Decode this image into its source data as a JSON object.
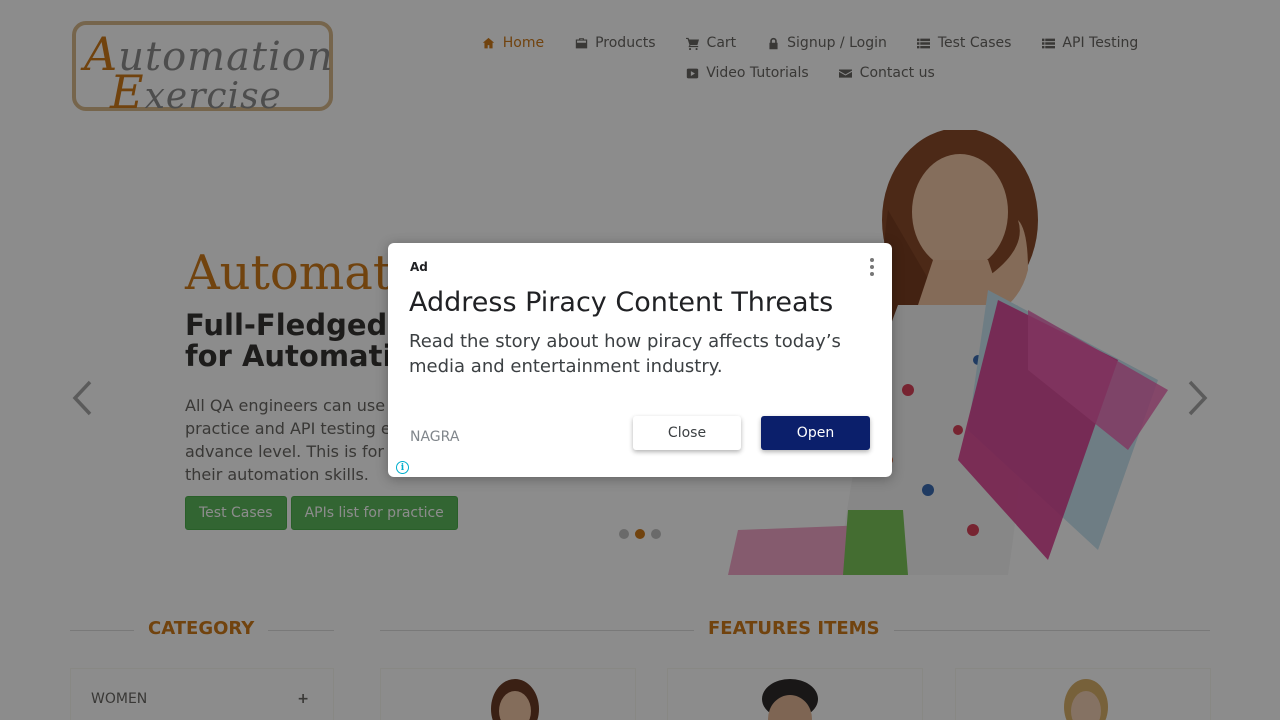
{
  "logo": {
    "line1_cap": "A",
    "line1_rest": "utomation",
    "line2_cap": "E",
    "line2_rest": "xercise"
  },
  "nav": {
    "items": [
      {
        "label": "Home",
        "icon": "home-icon"
      },
      {
        "label": "Products",
        "icon": "briefcase-icon"
      },
      {
        "label": "Cart",
        "icon": "cart-icon"
      },
      {
        "label": "Signup / Login",
        "icon": "lock-icon"
      },
      {
        "label": "Test Cases",
        "icon": "list-icon"
      },
      {
        "label": "API Testing",
        "icon": "list-icon"
      },
      {
        "label": "Video Tutorials",
        "icon": "youtube-icon"
      },
      {
        "label": "Contact us",
        "icon": "envelope-icon"
      }
    ]
  },
  "hero": {
    "title": "Automat",
    "subtitle_line1": "Full-Fledged",
    "subtitle_line2": "for Automatic",
    "desc_line1": "All QA engineers can use",
    "desc_line2": "practice and API testing e",
    "desc_line3": "advance level. This is for",
    "desc_line4": "their automation skills.",
    "btn_test_cases": "Test Cases",
    "btn_apis": "APIs list for practice"
  },
  "sections": {
    "category": "CATEGORY",
    "features": "FEATURES ITEMS"
  },
  "category": {
    "first": "WOMEN",
    "toggle": "+"
  },
  "ad": {
    "tag": "Ad",
    "headline": "Address Piracy Content Threats",
    "body": "Read the story about how piracy affects today’s media and entertainment industry.",
    "brand": "NAGRA",
    "close_label": "Close",
    "open_label": "Open",
    "info_glyph": "i"
  },
  "colors": {
    "accent": "#ce7a1b",
    "button_green": "#5cb85c",
    "ad_open_bg": "#0b1f6b"
  }
}
